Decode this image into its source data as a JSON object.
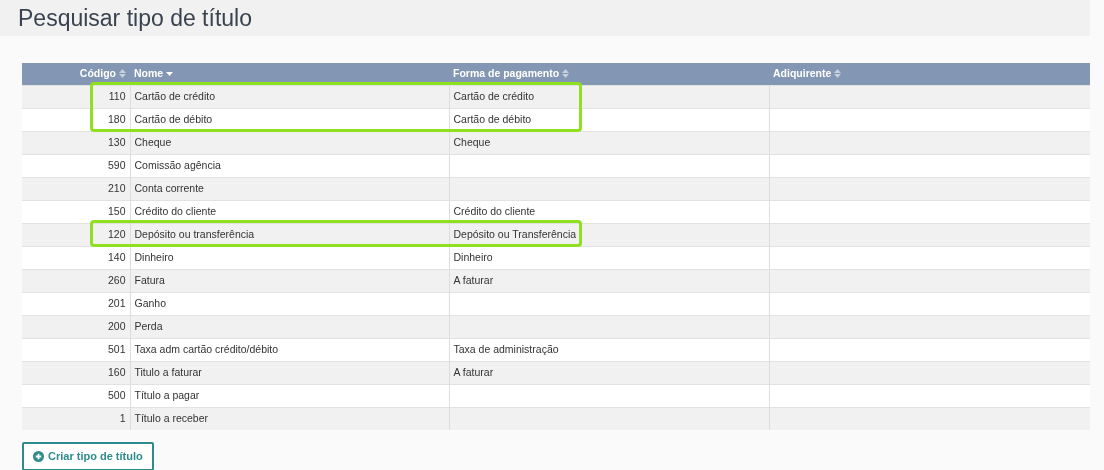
{
  "page_title": "Pesquisar tipo de título",
  "table": {
    "columns": [
      {
        "label": "Código",
        "sorted": false
      },
      {
        "label": "Nome",
        "sorted": true
      },
      {
        "label": "Forma de pagamento",
        "sorted": false
      },
      {
        "label": "Adiquirente",
        "sorted": false
      }
    ],
    "rows": [
      {
        "code": "110",
        "name": "Cartão de crédito",
        "payment": "Cartão de crédito",
        "highlighted": true
      },
      {
        "code": "180",
        "name": "Cartão de débito",
        "payment": "Cartão de débito",
        "highlighted": true
      },
      {
        "code": "130",
        "name": "Cheque",
        "payment": "Cheque",
        "highlighted": false
      },
      {
        "code": "590",
        "name": "Comissão agência",
        "highlighted": false
      },
      {
        "code": "210",
        "name": "Conta corrente",
        "highlighted": false
      },
      {
        "code": "150",
        "name": "Crédito do cliente",
        "payment": "Crédito do cliente",
        "highlighted": false
      },
      {
        "code": "120",
        "name": "Depósito ou transferência",
        "payment": "Depósito ou Transferência",
        "highlighted": true
      },
      {
        "code": "140",
        "name": "Dinheiro",
        "payment": "Dinheiro",
        "highlighted": false
      },
      {
        "code": "260",
        "name": "Fatura",
        "payment": "A faturar",
        "highlighted": false
      },
      {
        "code": "201",
        "name": "Ganho",
        "highlighted": false
      },
      {
        "code": "200",
        "name": "Perda",
        "highlighted": false
      },
      {
        "code": "501",
        "name": "Taxa adm cartão crédito/débito",
        "payment": "Taxa de administração",
        "highlighted": false
      },
      {
        "code": "160",
        "name": "Titulo a faturar",
        "payment": "A faturar",
        "highlighted": false
      },
      {
        "code": "500",
        "name": "Título a pagar",
        "highlighted": false
      },
      {
        "code": "1",
        "name": "Título a receber",
        "highlighted": false
      }
    ]
  },
  "create_button": "Criar tipo de título"
}
